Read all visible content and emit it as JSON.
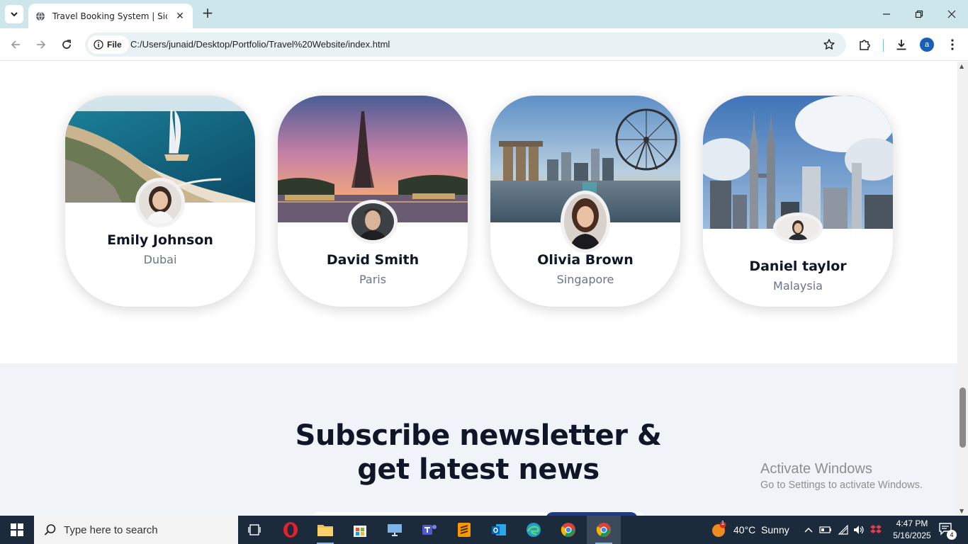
{
  "browser": {
    "tab_title": "Travel Booking System | Siddiqui",
    "url_chip": "File",
    "url": "C:/Users/junaid/Desktop/Portfolio/Travel%20Website/index.html",
    "profile_initial": "a"
  },
  "travelers": [
    {
      "name": "Emily Johnson",
      "city": "Dubai"
    },
    {
      "name": "David Smith",
      "city": "Paris"
    },
    {
      "name": "Olivia Brown",
      "city": "Singapore"
    },
    {
      "name": "Daniel taylor",
      "city": "Malaysia"
    }
  ],
  "newsletter": {
    "title_line1": "Subscribe newsletter &",
    "title_line2": "get latest news"
  },
  "watermark": {
    "line1": "Activate Windows",
    "line2": "Go to Settings to activate Windows."
  },
  "taskbar": {
    "search_placeholder": "Type here to search",
    "weather": "40°C  Sunny",
    "weather_badge": "1",
    "time": "4:47 PM",
    "date": "5/16/2025",
    "notification_count": "4"
  },
  "colors": {
    "tabbar": "#cde6ec",
    "heading": "#0f1627",
    "subtext": "#6b7488",
    "newsletter_bg": "#f0f3f7",
    "button_blue": "#1e3a8a",
    "taskbar": "#1c2b3c"
  }
}
